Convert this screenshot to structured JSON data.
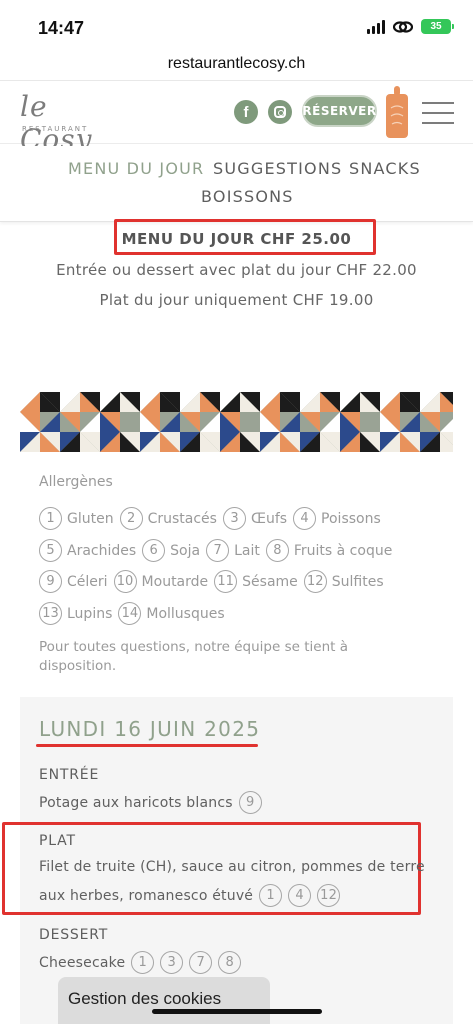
{
  "status_bar": {
    "time": "14:47",
    "battery": "35"
  },
  "browser": {
    "url": "restaurantlecosy.ch"
  },
  "header": {
    "logo_text": "le Cosy",
    "logo_subtext": "RESTAURANT",
    "facebook_icon": "facebook-icon",
    "instagram_icon": "instagram-icon",
    "reserve_label": "RÉSERVER",
    "board_icon": "cutting-board-icon",
    "menu_icon": "hamburger-menu-icon"
  },
  "tabs": [
    {
      "label": "MENU DU JOUR",
      "active": true
    },
    {
      "label": "SUGGESTIONS",
      "active": false
    },
    {
      "label": "SNACKS",
      "active": false
    },
    {
      "label": "BOISSONS",
      "active": false
    }
  ],
  "menu": {
    "headline": "MENU DU JOUR CHF 25.00",
    "option_1": "Entrée ou dessert avec plat du jour CHF 22.00",
    "option_2": "Plat du jour uniquement CHF 19.00"
  },
  "allergens": {
    "title": "Allergènes",
    "items": [
      {
        "num": "1",
        "name": "Gluten"
      },
      {
        "num": "2",
        "name": "Crustacés"
      },
      {
        "num": "3",
        "name": "Œufs"
      },
      {
        "num": "4",
        "name": "Poissons"
      },
      {
        "num": "5",
        "name": "Arachides"
      },
      {
        "num": "6",
        "name": "Soja"
      },
      {
        "num": "7",
        "name": "Lait"
      },
      {
        "num": "8",
        "name": "Fruits à coque"
      },
      {
        "num": "9",
        "name": "Céleri"
      },
      {
        "num": "10",
        "name": "Moutarde"
      },
      {
        "num": "11",
        "name": "Sésame"
      },
      {
        "num": "12",
        "name": "Sulfites"
      },
      {
        "num": "13",
        "name": "Lupins"
      },
      {
        "num": "14",
        "name": "Mollusques"
      }
    ],
    "note": "Pour toutes questions, notre équipe se tient à disposition."
  },
  "day": {
    "title": "LUNDI 16 JUIN 2025",
    "entree_label": "ENTRÉE",
    "entree_dish": "Potage aux haricots blancs",
    "entree_allergens": [
      "9"
    ],
    "plat_label": "PLAT",
    "plat_dish_line1": "Filet de truite (CH), sauce au citron, pommes de terre",
    "plat_dish_line2": "aux herbes, romanesco étuvé",
    "plat_allergens": [
      "1",
      "4",
      "12"
    ],
    "dessert_label": "DESSERT",
    "dessert_dish": "Cheesecake",
    "dessert_allergens": [
      "1",
      "3",
      "7",
      "8"
    ]
  },
  "cookie_banner": {
    "label": "Gestion des cookies"
  },
  "colors": {
    "accent_green": "#90a18c",
    "annotation_red": "#e0322f",
    "button_green": "#8ea789",
    "board_orange": "#e8925c"
  }
}
